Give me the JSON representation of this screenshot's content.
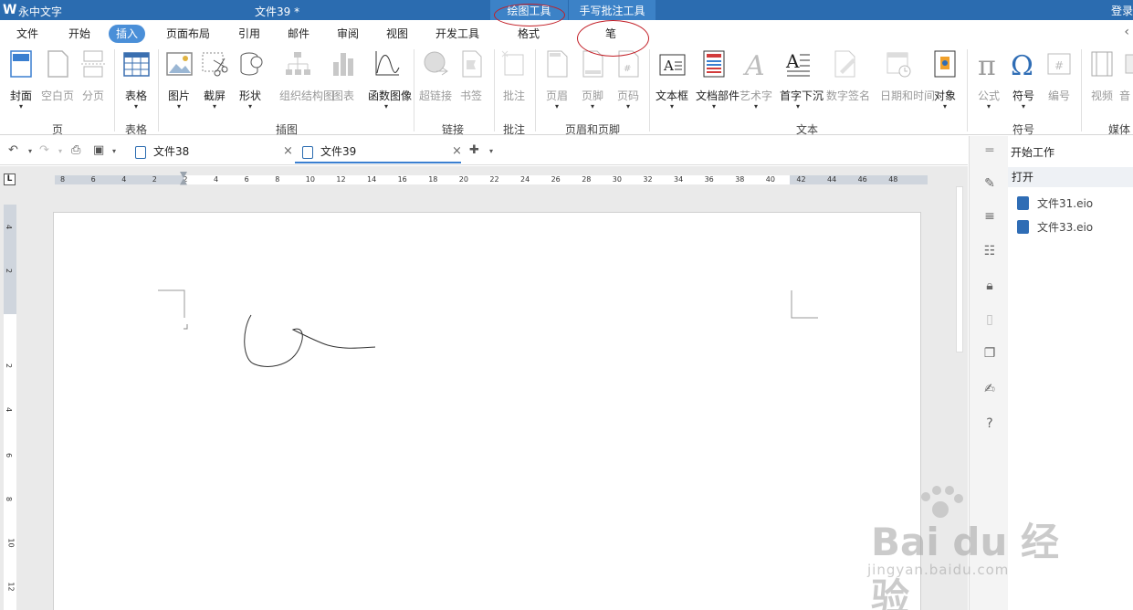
{
  "titlebar": {
    "app_name": "永中文字",
    "doc_title": "文件39 *",
    "context_tab_drawing": "绘图工具",
    "context_tab_handwriting": "手写批注工具",
    "login": "登录"
  },
  "menu_tabs": [
    "文件",
    "开始",
    "插入",
    "页面布局",
    "引用",
    "邮件",
    "审阅",
    "视图",
    "开发工具",
    "格式",
    "笔"
  ],
  "ribbon": {
    "page_group": {
      "label": "页",
      "items": [
        "封面",
        "空白页",
        "分页"
      ]
    },
    "table_group": {
      "label": "表格",
      "items": [
        "表格"
      ]
    },
    "illustration_group": {
      "label": "插图",
      "items": [
        "图片",
        "截屏",
        "形状",
        "组织结构图",
        "图表",
        "函数图像"
      ]
    },
    "link_group": {
      "label": "链接",
      "items": [
        "超链接",
        "书签"
      ]
    },
    "comment_group": {
      "label": "批注",
      "items": [
        "批注"
      ]
    },
    "header_footer_group": {
      "label": "页眉和页脚",
      "items": [
        "页眉",
        "页脚",
        "页码"
      ]
    },
    "text_group": {
      "label": "文本",
      "items": [
        "文本框",
        "文档部件",
        "艺术字",
        "首字下沉",
        "数字签名",
        "日期和时间",
        "对象"
      ]
    },
    "symbol_group": {
      "label": "符号",
      "items": [
        "公式",
        "符号",
        "编号"
      ]
    },
    "media_group": {
      "label": "媒体",
      "items": [
        "视频",
        "音"
      ]
    }
  },
  "doc_tabs": [
    {
      "title": "文件38"
    },
    {
      "title": "文件39"
    }
  ],
  "ruler": {
    "h_ticks": [
      "8",
      "6",
      "4",
      "2",
      "2",
      "4",
      "6",
      "8",
      "10",
      "12",
      "14",
      "16",
      "18",
      "20",
      "22",
      "24",
      "26",
      "28",
      "30",
      "32",
      "34",
      "36",
      "38",
      "40",
      "42",
      "44",
      "46",
      "48"
    ],
    "v_ticks": [
      "4",
      "2",
      "2",
      "4",
      "6",
      "8",
      "10",
      "12"
    ],
    "corner": "L"
  },
  "panel": {
    "header": "开始工作",
    "open_label": "打开",
    "files": [
      "文件31.eio",
      "文件33.eio"
    ]
  },
  "watermark": {
    "main": "Bai du 经验",
    "sub": "jingyan.baidu.com"
  },
  "colors": {
    "titlebar": "#2b6cb0",
    "active_tab": "#4a8fd8",
    "annotation": "#c21e26"
  }
}
